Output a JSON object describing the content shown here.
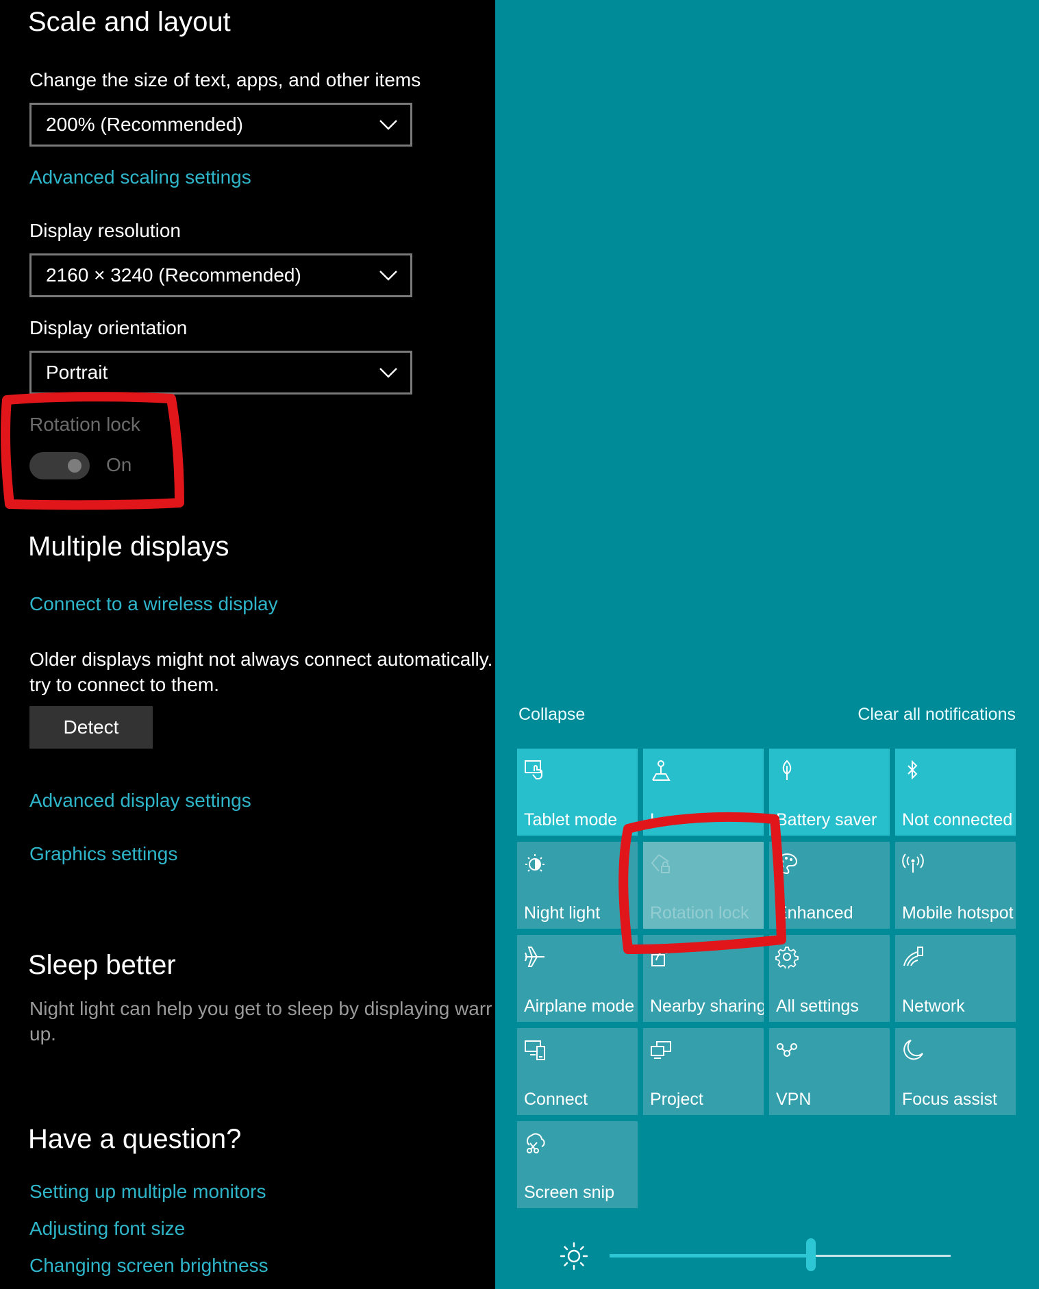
{
  "settings": {
    "scale_layout": {
      "heading": "Scale and layout",
      "size_label": "Change the size of text, apps, and other items",
      "size_value": "200% (Recommended)",
      "advanced_scaling_link": "Advanced scaling settings",
      "resolution_label": "Display resolution",
      "resolution_value": "2160 × 3240 (Recommended)",
      "orientation_label": "Display orientation",
      "orientation_value": "Portrait",
      "rotation_lock_label": "Rotation lock",
      "rotation_lock_state": "On"
    },
    "multiple_displays": {
      "heading": "Multiple displays",
      "wireless_link": "Connect to a wireless display",
      "older_text_line1": "Older displays might not always connect automatically.",
      "older_text_line2": "try to connect to them.",
      "detect_button": "Detect",
      "advanced_display_link": "Advanced display settings",
      "graphics_link": "Graphics settings"
    },
    "sleep_better": {
      "heading": "Sleep better",
      "text_line1": "Night light can help you get to sleep by displaying warr",
      "text_line2": "up."
    },
    "question": {
      "heading": "Have a question?",
      "links": [
        "Setting up multiple monitors",
        "Adjusting font size",
        "Changing screen brightness"
      ]
    }
  },
  "action_center": {
    "collapse_label": "Collapse",
    "clear_label": "Clear all notifications",
    "tiles": [
      {
        "label": "Tablet mode",
        "icon": "tablet-mode-icon",
        "state": "on"
      },
      {
        "label": "L",
        "icon": "location-icon",
        "state": "on"
      },
      {
        "label": "Battery saver",
        "icon": "battery-saver-icon",
        "state": "on"
      },
      {
        "label": "Not connected",
        "icon": "bluetooth-icon",
        "state": "on"
      },
      {
        "label": "Night light",
        "icon": "night-light-icon",
        "state": "default"
      },
      {
        "label": "Rotation lock",
        "icon": "rotation-lock-icon",
        "state": "disabled"
      },
      {
        "label": "Enhanced",
        "icon": "palette-icon",
        "state": "default"
      },
      {
        "label": "Mobile hotspot",
        "icon": "mobile-hotspot-icon",
        "state": "default"
      },
      {
        "label": "Airplane mode",
        "icon": "airplane-icon",
        "state": "default"
      },
      {
        "label": "Nearby sharing",
        "icon": "nearby-sharing-icon",
        "state": "default"
      },
      {
        "label": "All settings",
        "icon": "gear-icon",
        "state": "default"
      },
      {
        "label": "Network",
        "icon": "network-icon",
        "state": "default"
      },
      {
        "label": "Connect",
        "icon": "connect-icon",
        "state": "default"
      },
      {
        "label": "Project",
        "icon": "project-icon",
        "state": "default"
      },
      {
        "label": "VPN",
        "icon": "vpn-icon",
        "state": "default"
      },
      {
        "label": "Focus assist",
        "icon": "moon-icon",
        "state": "default"
      },
      {
        "label": "Screen snip",
        "icon": "screen-snip-icon",
        "state": "default"
      }
    ],
    "brightness": 0.59
  },
  "colors": {
    "settings_bg": "#000000",
    "link": "#2fb5c9",
    "action_center_bg": "#008b99",
    "tile_on": "#28bfcd",
    "tile_default": "#35a0ab",
    "marker": "#e0161b"
  }
}
